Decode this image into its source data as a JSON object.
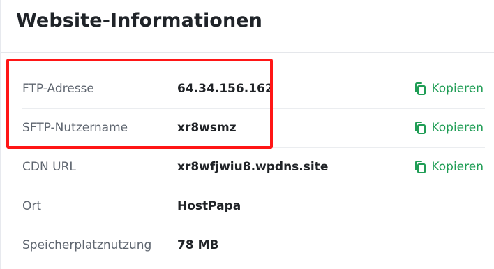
{
  "section": {
    "title": "Website-Informationen"
  },
  "rows": [
    {
      "label": "FTP-Adresse",
      "value": "64.34.156.162",
      "copy_label": "Kopieren"
    },
    {
      "label": "SFTP-Nutzername",
      "value": "xr8wsmz",
      "copy_label": "Kopieren"
    },
    {
      "label": "CDN URL",
      "value": "xr8wfjwiu8.wpdns.site",
      "copy_label": "Kopieren"
    },
    {
      "label": "Ort",
      "value": "HostPapa"
    },
    {
      "label": "Speicherplatznutzung",
      "value": "78 MB"
    }
  ],
  "colors": {
    "accent": "#1f9d55",
    "highlight": "#ff1616",
    "label_text": "#5f6670",
    "value_text": "#202327"
  },
  "icons": {
    "copy": "copy-icon"
  }
}
